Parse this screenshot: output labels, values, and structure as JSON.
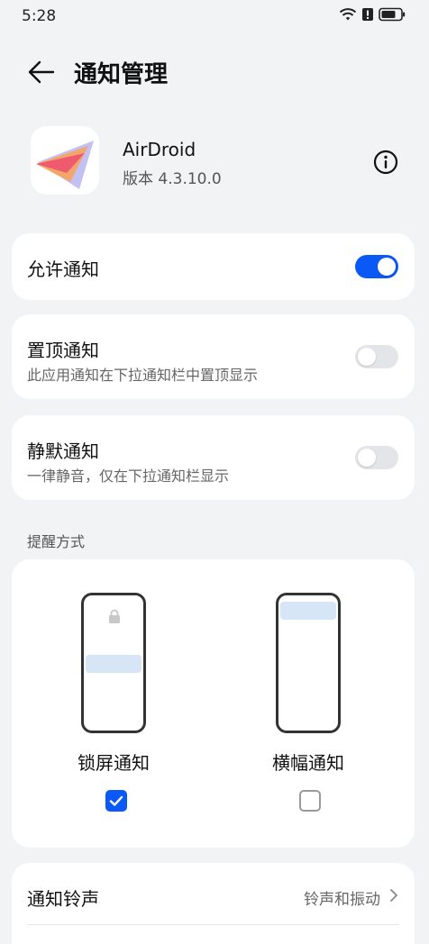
{
  "status_bar": {
    "time": "5:28"
  },
  "header": {
    "title": "通知管理"
  },
  "app": {
    "name": "AirDroid",
    "version": "版本 4.3.10.0"
  },
  "settings": {
    "allow": {
      "title": "允许通知",
      "enabled": true
    },
    "pinned": {
      "title": "置顶通知",
      "subtitle": "此应用通知在下拉通知栏中置顶显示",
      "enabled": false
    },
    "silent": {
      "title": "静默通知",
      "subtitle": "一律静音，仅在下拉通知栏显示",
      "enabled": false
    }
  },
  "reminder": {
    "label": "提醒方式",
    "modes": [
      {
        "label": "锁屏通知",
        "checked": true
      },
      {
        "label": "横幅通知",
        "checked": false
      }
    ]
  },
  "ringtone": {
    "title": "通知铃声",
    "value": "铃声和振动"
  },
  "colors": {
    "accent": "#0a59f7",
    "background": "#f1f3f5",
    "card": "#ffffff"
  },
  "icons": [
    "wifi-icon",
    "alert-icon",
    "battery-icon",
    "back-arrow-icon",
    "info-icon",
    "lock-icon",
    "check-icon",
    "chevron-right-icon"
  ]
}
